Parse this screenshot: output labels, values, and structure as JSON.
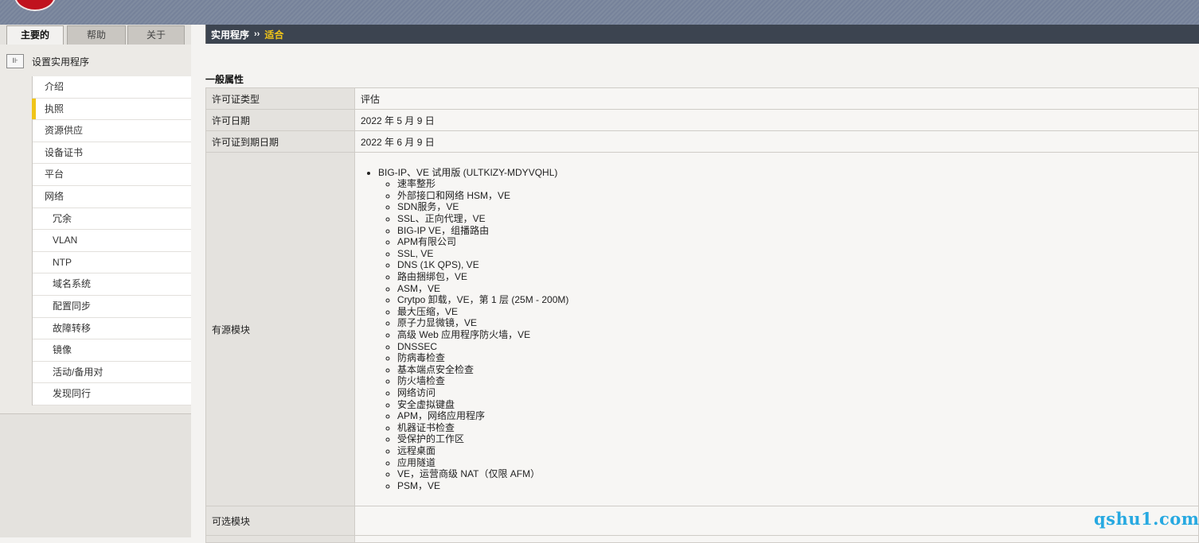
{
  "tabs": [
    {
      "label": "主要的",
      "active": true
    },
    {
      "label": "帮助",
      "active": false
    },
    {
      "label": "关于",
      "active": false
    }
  ],
  "sidebar": {
    "section_title": "设置实用程序",
    "items": [
      {
        "label": "介绍",
        "sub": false,
        "selected": false
      },
      {
        "label": "执照",
        "sub": false,
        "selected": true
      },
      {
        "label": "资源供应",
        "sub": false,
        "selected": false
      },
      {
        "label": "设备证书",
        "sub": false,
        "selected": false
      },
      {
        "label": "平台",
        "sub": false,
        "selected": false
      },
      {
        "label": "网络",
        "sub": false,
        "selected": false
      },
      {
        "label": "冗余",
        "sub": true,
        "selected": false
      },
      {
        "label": "VLAN",
        "sub": true,
        "selected": false
      },
      {
        "label": "NTP",
        "sub": true,
        "selected": false
      },
      {
        "label": "域名系统",
        "sub": true,
        "selected": false
      },
      {
        "label": "配置同步",
        "sub": true,
        "selected": false
      },
      {
        "label": "故障转移",
        "sub": true,
        "selected": false
      },
      {
        "label": "镜像",
        "sub": true,
        "selected": false
      },
      {
        "label": "活动/备用对",
        "sub": true,
        "selected": false
      },
      {
        "label": "发现同行",
        "sub": true,
        "selected": false
      }
    ]
  },
  "breadcrumb": {
    "root": "实用程序",
    "separator": "››",
    "current": "适合"
  },
  "general": {
    "title": "一般属性",
    "rows": {
      "license_type": {
        "label": "许可证类型",
        "value": "评估"
      },
      "license_date": {
        "label": "许可日期",
        "value": "2022 年 5 月 9 日"
      },
      "license_expire": {
        "label": "许可证到期日期",
        "value": "2022 年 6 月 9 日"
      },
      "active_modules": {
        "label": "有源模块",
        "product": "BIG-IP、VE 试用版 (ULTKIZY-MDYVQHL)",
        "features": [
          "速率整形",
          "外部接口和网络 HSM，VE",
          "SDN服务，VE",
          "SSL、正向代理，VE",
          "BIG-IP VE，组播路由",
          "APM有限公司",
          "SSL, VE",
          "DNS (1K QPS), VE",
          "路由捆绑包，VE",
          "ASM，VE",
          "Crytpo 卸载，VE，第 1 层 (25M - 200M)",
          "最大压缩，VE",
          "原子力显微镜，VE",
          "高级 Web 应用程序防火墙，VE",
          "DNSSEC",
          "防病毒检查",
          "基本端点安全检查",
          "防火墙检查",
          "网络访问",
          "安全虚拟键盘",
          "APM，网络应用程序",
          "机器证书检查",
          "受保护的工作区",
          "远程桌面",
          "应用隧道",
          "VE，运营商级 NAT（仅限 AFM）",
          "PSM，VE"
        ]
      },
      "optional_modules": {
        "label": "可选模块",
        "value": ""
      }
    }
  },
  "watermark": "qshu1.com",
  "colors": {
    "accent": "#f0c419",
    "header_bar": "#3c4450",
    "watermark": "#27a9e1"
  }
}
